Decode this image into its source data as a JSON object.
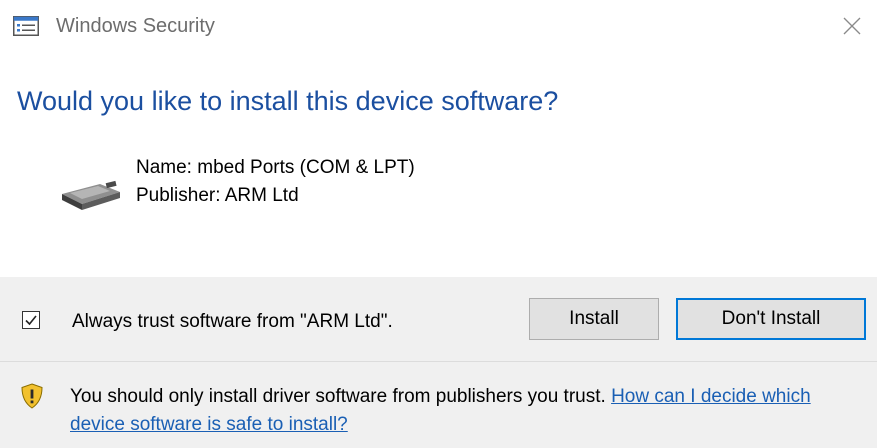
{
  "window": {
    "title": "Windows Security",
    "title_icon": "windows-security-icon",
    "close_icon": "close-icon"
  },
  "heading": "Would you like to install this device software?",
  "device": {
    "icon": "device-ports-icon",
    "name_line": "Name: mbed Ports (COM & LPT)",
    "publisher_line": "Publisher: ARM Ltd"
  },
  "trust": {
    "checked": true,
    "label": "Always trust software from \"ARM Ltd\"."
  },
  "buttons": {
    "install": "Install",
    "dont_install": "Don't Install"
  },
  "warning": {
    "icon": "shield-warning-icon",
    "text": "You should only install driver software from publishers you trust. ",
    "link": "How can I decide which device software is safe to install?"
  },
  "colors": {
    "heading": "#1b4fa0",
    "link": "#1a5fb4",
    "focus_border": "#0078d7",
    "footer_bg": "#f0f0f0",
    "warning_shield": "#f2c12e"
  }
}
